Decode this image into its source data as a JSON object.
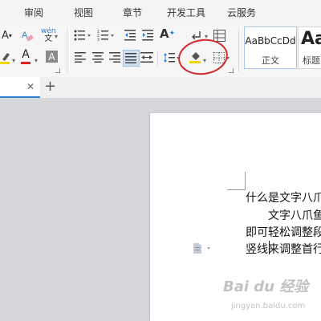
{
  "menubar": {
    "items": [
      "审阅",
      "视图",
      "章节",
      "开发工具",
      "云服务"
    ]
  },
  "ribbon": {
    "font_shrink_glyph": "A",
    "phonetic_glyph": "wén",
    "phonetic_sub_glyph": "文",
    "font_color_glyph": "A",
    "char_shading_glyph": "A",
    "text_effect_glyph": "A",
    "styles": [
      {
        "sample": "AaBbCcDd",
        "name": "正文"
      },
      {
        "sample": "Aa",
        "name": "标题"
      }
    ],
    "colors": {
      "highlight_bar": "#f2d600",
      "font_color_bar": "#e02020",
      "shading_bar": "#f2d600",
      "annotation_circle": "#d42a2a"
    }
  },
  "tabs": {
    "close_glyph": "✕",
    "add_glyph": "+"
  },
  "document": {
    "lines": [
      "什么是文字八爪",
      "文字八爪鱼",
      "即可轻松调整段",
      "竖线来调整首行"
    ]
  },
  "watermark": {
    "text": "Bai du 经验",
    "sub": "jingyan.baidu.com"
  }
}
